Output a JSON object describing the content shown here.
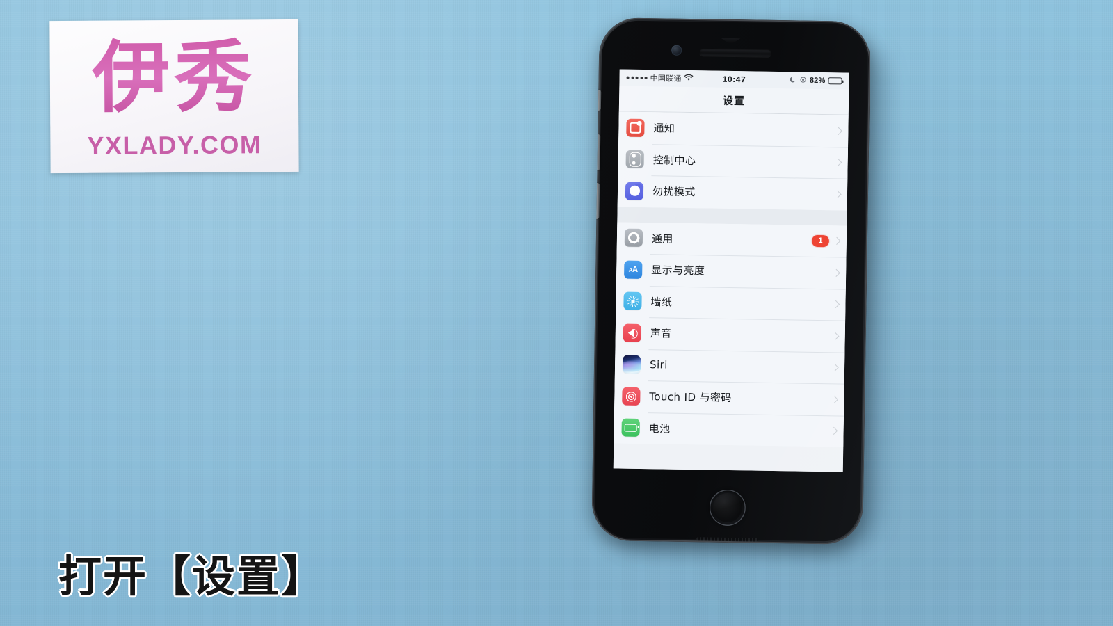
{
  "background": {
    "color": "#8dc0dc"
  },
  "watermark": {
    "logo_text": "伊秀",
    "domain_text": "YXLADY.COM",
    "brand_color": "#c75fa8"
  },
  "caption": {
    "text": "打开【设置】"
  },
  "phone": {
    "device": "iPhone",
    "hardware": {
      "front_camera": "front-camera",
      "earpiece": "earpiece-speaker",
      "home_button": "home-button",
      "mute_switch": "mute-switch",
      "volume_up": "volume-up-button",
      "volume_down": "volume-down-button"
    },
    "screen": {
      "status_bar": {
        "signal_dots": 5,
        "carrier": "中国联通",
        "wifi": "wifi-icon",
        "time": "10:47",
        "dnd": "moon-icon",
        "location": "location-icon",
        "battery_percent": "82%",
        "battery_level": 82
      },
      "nav_bar": {
        "title": "设置"
      },
      "groups": [
        {
          "rows": [
            {
              "label": "通知",
              "icon": "notifications-icon",
              "icon_color": "#e8443a",
              "badge": null,
              "chevron": true
            },
            {
              "label": "控制中心",
              "icon": "control-center-icon",
              "icon_color": "#a3a9b0",
              "badge": null,
              "chevron": true
            },
            {
              "label": "勿扰模式",
              "icon": "do-not-disturb-icon",
              "icon_color": "#5a64e2",
              "badge": null,
              "chevron": true
            }
          ]
        },
        {
          "rows": [
            {
              "label": "通用",
              "icon": "general-icon",
              "icon_color": "#9fa5ac",
              "badge": "1",
              "chevron": true
            },
            {
              "label": "显示与亮度",
              "icon": "display-icon",
              "icon_color": "#3b90e6",
              "badge": null,
              "chevron": true
            },
            {
              "label": "墙纸",
              "icon": "wallpaper-icon",
              "icon_color": "#4fb8e9",
              "badge": null,
              "chevron": true
            },
            {
              "label": "声音",
              "icon": "sounds-icon",
              "icon_color": "#ec4a57",
              "badge": null,
              "chevron": true
            },
            {
              "label": "Siri",
              "icon": "siri-icon",
              "icon_color": "#1c2f6e",
              "badge": null,
              "chevron": true
            },
            {
              "label": "Touch ID 与密码",
              "icon": "touch-id-icon",
              "icon_color": "#e84452",
              "badge": null,
              "chevron": true
            },
            {
              "label": "电池",
              "icon": "battery-icon",
              "icon_color": "#3cc15e",
              "badge": null,
              "chevron": true
            }
          ]
        }
      ]
    }
  }
}
